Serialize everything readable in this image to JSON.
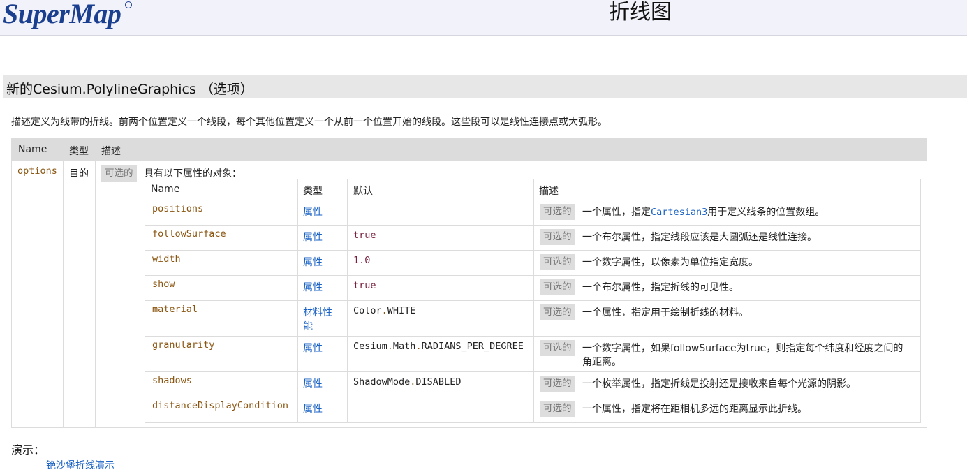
{
  "header": {
    "logo_text": "SuperMap",
    "page_title": "折线图"
  },
  "section": {
    "title": "新的Cesium.PolylineGraphics （选项）",
    "description": "描述定义为线带的折线。前两个位置定义一个线段，每个其他位置定义一个从前一个位置开始的线段。这些段可以是线性连接点或大弧形。"
  },
  "params_table": {
    "headers": [
      "Name",
      "类型",
      "描述"
    ],
    "row": {
      "name": "options",
      "type": "目的",
      "optional_badge": "可选的",
      "description": "具有以下属性的对象："
    }
  },
  "options_table": {
    "headers": [
      "Name",
      "类型",
      "默认",
      "描述"
    ],
    "rows": [
      {
        "name": "positions",
        "type": "属性",
        "default": "",
        "optional": "可选的",
        "desc_pre": "一个属性，指定",
        "desc_link": "Cartesian3",
        "desc_post": "用于定义线条的位置数组。"
      },
      {
        "name": "followSurface",
        "type": "属性",
        "default": "true",
        "optional": "可选的",
        "desc": "一个布尔属性，指定线段应该是大圆弧还是线性连接。"
      },
      {
        "name": "width",
        "type": "属性",
        "default": "1.0",
        "optional": "可选的",
        "desc": "一个数字属性，以像素为单位指定宽度。"
      },
      {
        "name": "show",
        "type": "属性",
        "default": "true",
        "optional": "可选的",
        "desc": "一个布尔属性，指定折线的可见性。"
      },
      {
        "name": "material",
        "type_line1": "材料性",
        "type_line2": "能",
        "default_a": "Color",
        "default_b": "WHITE",
        "optional": "可选的",
        "desc": "一个属性，指定用于绘制折线的材料。"
      },
      {
        "name": "granularity",
        "type": "属性",
        "default_a": "Cesium",
        "default_b": "Math",
        "default_c": "RADIANS_PER_DEGREE",
        "optional": "可选的",
        "desc_line1": "一个数字属性，如果followSurface为true，则指定每个纬度和经度之间的",
        "desc_line2": "角距离。"
      },
      {
        "name": "shadows",
        "type": "属性",
        "default_a": "ShadowMode",
        "default_b": "DISABLED",
        "optional": "可选的",
        "desc": "一个枚举属性，指定折线是投射还是接收来自每个光源的阴影。"
      },
      {
        "name": "distanceDisplayCondition",
        "type": "属性",
        "default": "",
        "optional": "可选的",
        "desc": "一个属性，指定将在距相机多远的距离显示此折线。"
      }
    ]
  },
  "demo": {
    "label": "演示：",
    "link": "铯沙堡折线演示"
  },
  "colors": {
    "brand": "#1b3f8f",
    "link": "#1a62c4",
    "property_name": "#8a5510",
    "literal": "#7a1f3f"
  }
}
